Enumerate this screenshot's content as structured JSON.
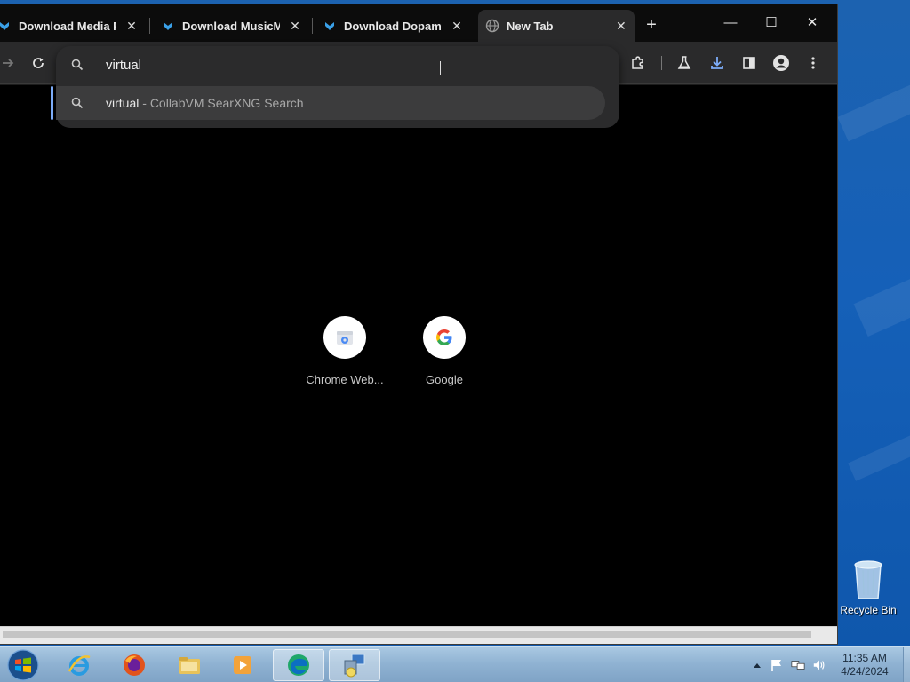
{
  "browser": {
    "tabs": [
      {
        "title": "Download Media Pla",
        "icon": "download-arrow-icon",
        "close": "✕"
      },
      {
        "title": "Download MusicMat",
        "icon": "download-arrow-icon",
        "close": "✕"
      },
      {
        "title": "Download Dopamine",
        "icon": "download-arrow-icon",
        "close": "✕"
      },
      {
        "title": "New Tab",
        "icon": "globe-icon",
        "close": "✕",
        "active": true
      }
    ],
    "new_tab": "+",
    "window_controls": {
      "minimize": "—",
      "maximize": "☐",
      "close": "✕"
    },
    "omnibox": {
      "value": "virtual",
      "suggestion": {
        "query": "virtual",
        "separator": " - ",
        "source": "CollabVM SearXNG Search"
      }
    },
    "shortcuts": [
      {
        "label": "Chrome Web...",
        "icon": "chrome-web-store-icon"
      },
      {
        "label": "Google",
        "icon": "google-icon"
      }
    ],
    "colors": {
      "accent": "#7cacf8",
      "background": "#000000",
      "toolbar": "#2a2a2b"
    }
  },
  "desktop": {
    "recycle_bin": "Recycle Bin"
  },
  "taskbar": {
    "apps": [
      "internet-explorer-icon",
      "firefox-icon",
      "file-explorer-icon",
      "media-player-icon",
      "edge-icon",
      "network-setup-icon"
    ],
    "clock": {
      "time": "11:35 AM",
      "date": "4/24/2024"
    },
    "tray": [
      "show-hidden-icons",
      "flag-icon",
      "network-icon",
      "volume-icon"
    ]
  }
}
